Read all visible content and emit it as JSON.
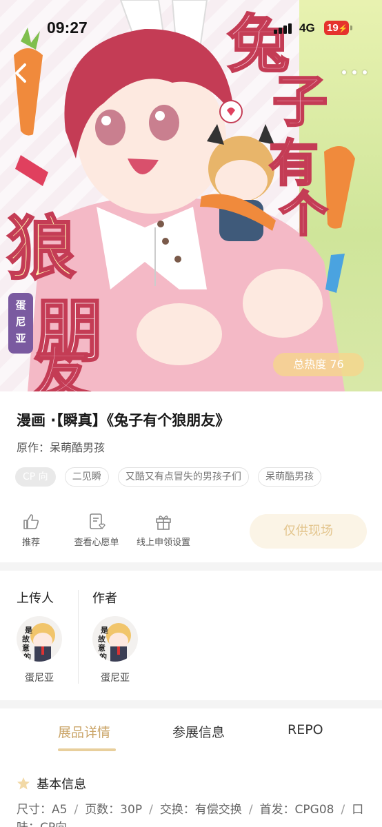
{
  "status_bar": {
    "time": "09:27",
    "network": "4G",
    "battery": "19"
  },
  "cover": {
    "title_art": "兔子有个狼朋友",
    "author_art": "蛋尼亚",
    "heat_label": "总热度 76"
  },
  "work": {
    "title": "漫画 ·【瞬真】《兔子有个狼朋友》",
    "original_author": "原作：呆萌酷男孩",
    "tags": [
      "CP 向",
      "二见瞬",
      "又酷又有点冒失的男孩子们",
      "呆萌酷男孩"
    ]
  },
  "actions": {
    "recommend": "推荐",
    "wishlist": "查看心愿单",
    "online_settings": "线上申领设置",
    "onsite_only": "仅供现场"
  },
  "people": {
    "uploader_label": "上传人",
    "author_label": "作者",
    "uploader_name": "蛋尼亚",
    "author_name": "蛋尼亚",
    "avatar_text": "是故意的"
  },
  "tabs": [
    "展品详情",
    "参展信息",
    "REPO"
  ],
  "basic_info": {
    "heading": "基本信息",
    "size": "尺寸：A5",
    "pages": "页数：30P",
    "exchange": "交换：有偿交换",
    "debut": "首发：CPG08",
    "flavor": "口味：CP向"
  },
  "colors": {
    "accent": "#caa467",
    "heat_badge": "#f5d68c",
    "onsite_text": "#e3c58d",
    "battery": "#e5322d"
  }
}
